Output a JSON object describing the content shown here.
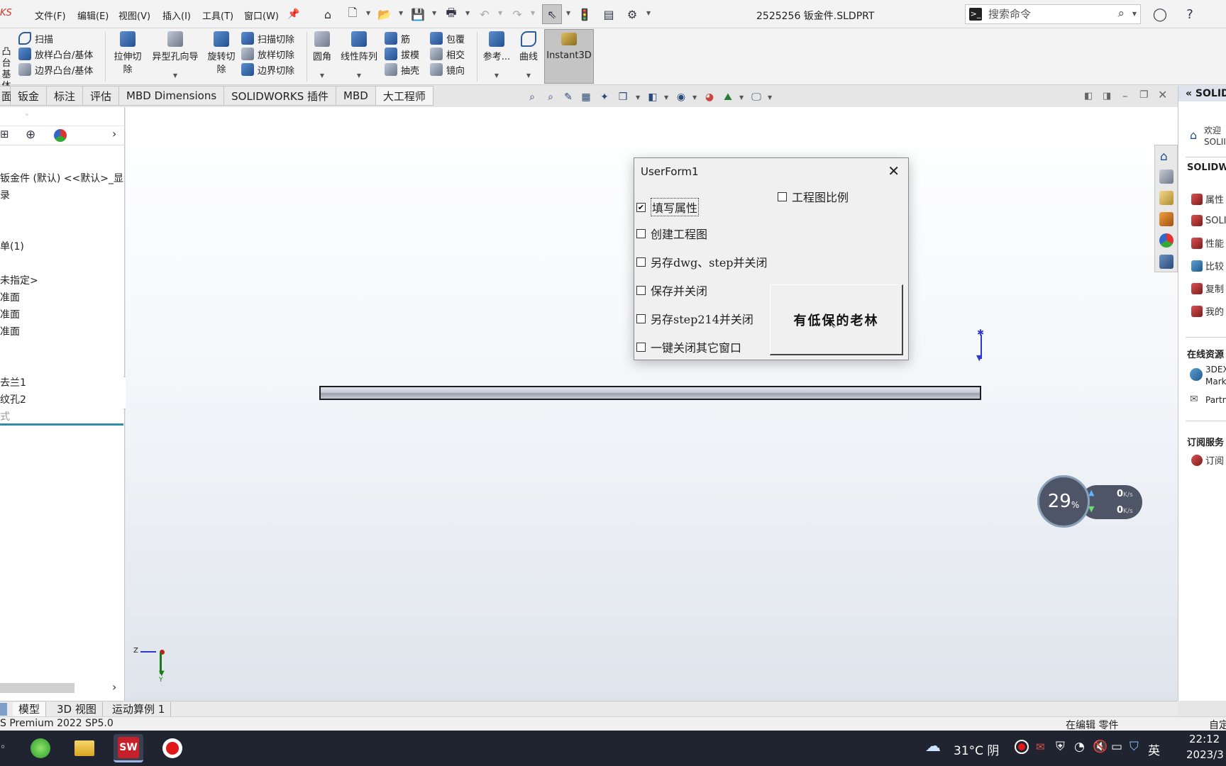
{
  "app": {
    "logo_text": "KS",
    "doc_title": "2525256 钣金件.SLDPRT"
  },
  "menu": [
    "文件(F)",
    "编辑(E)",
    "视图(V)",
    "插入(I)",
    "工具(T)",
    "窗口(W)"
  ],
  "search": {
    "placeholder": "搜索命令"
  },
  "ribbon": {
    "col1": [
      "扫描",
      "放样凸台/基体",
      "边界凸台/基体"
    ],
    "col1_left": [
      "凸台",
      "基体"
    ],
    "extrude_cut": [
      "拉伸切",
      "除"
    ],
    "hole_wizard": "异型孔向导",
    "revolve_cut": [
      "旋转切",
      "除"
    ],
    "col2": [
      "扫描切除",
      "放样切除",
      "边界切除"
    ],
    "fillet": "圆角",
    "linear_pattern": "线性阵列",
    "col3": [
      "筋",
      "拔模",
      "抽壳"
    ],
    "col4": [
      "包覆",
      "相交",
      "镜向"
    ],
    "reference": "参考...",
    "curves": "曲线",
    "instant3d": "Instant3D"
  },
  "tabs": [
    "面",
    "钣金",
    "标注",
    "评估",
    "MBD Dimensions",
    "SOLIDWORKS 插件",
    "MBD",
    "大工程师"
  ],
  "tree": {
    "root": "钣金件 (默认) <<默认>_显",
    "items": [
      "录",
      "单(1)",
      "未指定>",
      "准面",
      "准面",
      "准面",
      "去兰1",
      "纹孔2",
      "式"
    ]
  },
  "dialog": {
    "title": "UserForm1",
    "checkboxes": [
      {
        "label": "填写属性",
        "checked": true
      },
      {
        "label": "创建工程图",
        "checked": false
      },
      {
        "label": "另存dwg、step并关闭",
        "checked": false
      },
      {
        "label": "保存并关闭",
        "checked": false
      },
      {
        "label": "另存step214并关闭",
        "checked": false
      },
      {
        "label": "一键关闭其它窗口",
        "checked": false
      },
      {
        "label": "工程图比例",
        "checked": false
      }
    ],
    "button_label": "有低保的老林"
  },
  "triad": {
    "z": "Z",
    "y": "Y"
  },
  "right_panel": {
    "header": "SOLID",
    "welcome": [
      "欢迎",
      "SOLII"
    ],
    "section1": "SOLIDW",
    "items": [
      "属性",
      "SOLI",
      "性能",
      "比较",
      "复制",
      "我的"
    ],
    "section2": "在线资源",
    "online": [
      "3DEX",
      "Mark",
      "Partn"
    ],
    "section3": "订阅服务",
    "subscribe": "订阅"
  },
  "network": {
    "percent": "29",
    "percent_unit": "%",
    "up": "0",
    "down": "0",
    "unit": "K/s"
  },
  "bottom_tabs": [
    "模型",
    "3D 视图",
    "运动算例 1"
  ],
  "status": {
    "left": "S Premium 2022 SP5.0",
    "middle": "在编辑 零件",
    "right": "自定"
  },
  "taskbar": {
    "weather": "31°C 阴",
    "ime": "英",
    "time": "22:12",
    "date": "2023/3"
  }
}
